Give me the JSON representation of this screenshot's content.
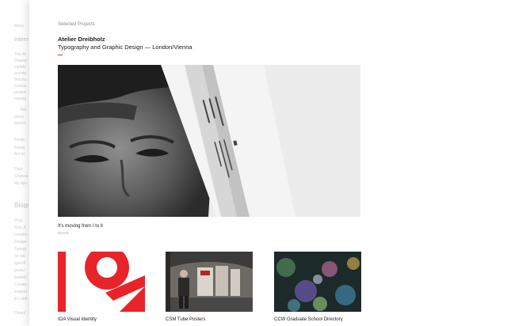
{
  "background_site": {
    "fragments": [
      "Abou",
      "Intern",
      "The At",
      "Display",
      "variety",
      "archite",
      "brochu",
      "Consis",
      "produc",
      "manag",
      "We",
      "every",
      "launch",
      "Fanta",
      "Focus",
      "Are lu",
      "Past",
      "Channe",
      "My tips",
      "Blogr",
      "Pros",
      "Stor. A",
      "London",
      "Design",
      "Typogr",
      "an edi",
      "specifi",
      "produ",
      "publish",
      "Creativ",
      "subject",
      "in Lond",
      "Downl"
    ]
  },
  "overlay": {
    "breadcrumb": "Selected Projects",
    "title": "Atelier Dreibholz",
    "subtitle": "Typography and Graphic Design — London/Vienna",
    "accent_color": "#e23b3b"
  },
  "featured": {
    "caption": "It's moving from I to it",
    "tag": "BOOK"
  },
  "thumbnails": [
    {
      "caption": "IOA Visual Identity"
    },
    {
      "caption": "CSM Tube Posters"
    },
    {
      "caption": "CCW Graduate School Directory"
    }
  ]
}
